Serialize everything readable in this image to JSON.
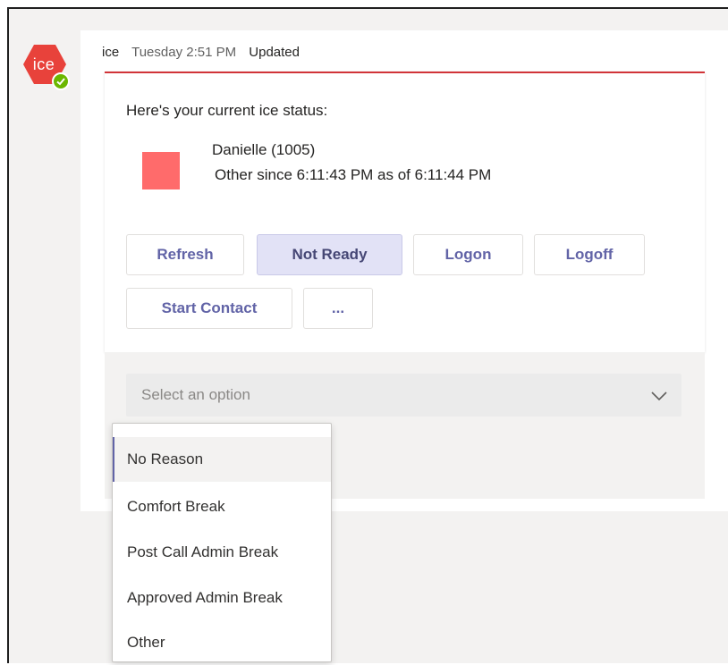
{
  "bot": {
    "avatar_text": "ice",
    "avatar_icon": "hexagon-logo-icon",
    "presence_icon": "available-check-icon",
    "avatar_color": "#e8423b",
    "presence_color": "#6bb700"
  },
  "message": {
    "sender": "ice",
    "timestamp": "Tuesday 2:51 PM",
    "edited_label": "Updated"
  },
  "card": {
    "heading": "Here's your current ice status:",
    "status_color": "#ff6b6b",
    "agent_name": "Danielle (1005)",
    "agent_status": "Other since 6:11:43 PM as of 6:11:44 PM",
    "buttons": [
      {
        "label": "Refresh"
      },
      {
        "label": "Not Ready"
      },
      {
        "label": "Logon"
      },
      {
        "label": "Logoff"
      },
      {
        "label": "Start Contact"
      },
      {
        "label": "..."
      }
    ],
    "active_button": "Not Ready"
  },
  "select": {
    "placeholder": "Select an option",
    "chevron_icon": "chevron-down-icon",
    "options": [
      {
        "label": "No Reason"
      },
      {
        "label": "Comfort Break"
      },
      {
        "label": "Post Call Admin Break"
      },
      {
        "label": "Approved Admin Break"
      },
      {
        "label": "Other"
      }
    ],
    "highlighted_option": "No Reason"
  },
  "colors": {
    "accent": "#6264a7",
    "card_top_border": "#d13438"
  }
}
